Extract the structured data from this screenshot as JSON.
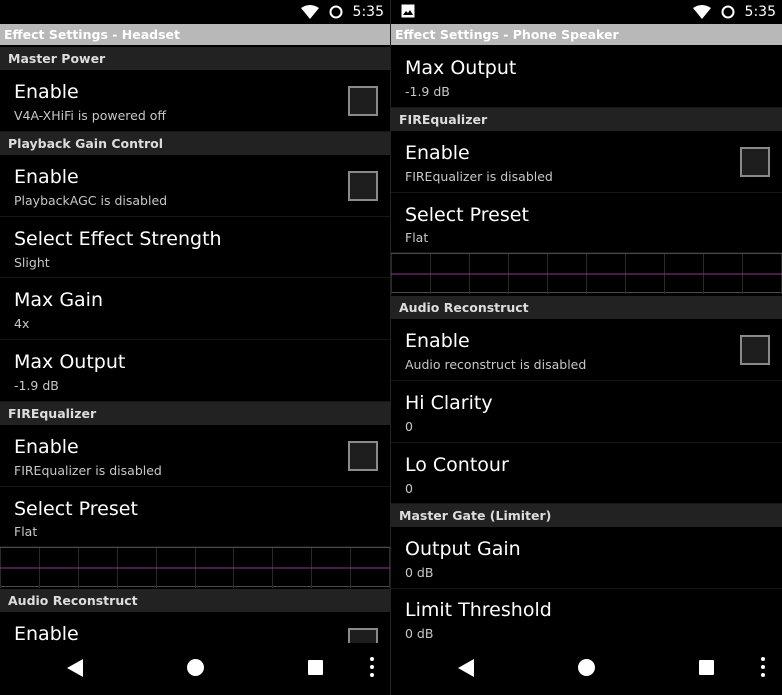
{
  "status": {
    "time": "5:35"
  },
  "left": {
    "title": "Effect Settings - Headset",
    "master_power": {
      "header": "Master Power",
      "enable_title": "Enable",
      "enable_summary": "V4A-XHiFi is powered off"
    },
    "playback_gain": {
      "header": "Playback Gain Control",
      "enable_title": "Enable",
      "enable_summary": "PlaybackAGC is disabled",
      "strength_title": "Select Effect Strength",
      "strength_value": "Slight",
      "max_gain_title": "Max Gain",
      "max_gain_value": "4x",
      "max_output_title": "Max Output",
      "max_output_value": "-1.9 dB"
    },
    "fir_equalizer": {
      "header": "FIREqualizer",
      "enable_title": "Enable",
      "enable_summary": "FIREqualizer is disabled",
      "preset_title": "Select Preset",
      "preset_value": "Flat"
    },
    "audio_reconstruct": {
      "header": "Audio Reconstruct",
      "enable_title": "Enable"
    }
  },
  "right": {
    "title": "Effect Settings - Phone Speaker",
    "max_output_title": "Max Output",
    "max_output_value": "-1.9 dB",
    "fir_equalizer": {
      "header": "FIREqualizer",
      "enable_title": "Enable",
      "enable_summary": "FIREqualizer is disabled",
      "preset_title": "Select Preset",
      "preset_value": "Flat"
    },
    "audio_reconstruct": {
      "header": "Audio Reconstruct",
      "enable_title": "Enable",
      "enable_summary": "Audio reconstruct is disabled",
      "hi_clarity_title": "Hi Clarity",
      "hi_clarity_value": "0",
      "lo_contour_title": "Lo Contour",
      "lo_contour_value": "0"
    },
    "master_gate": {
      "header": "Master Gate (Limiter)",
      "output_gain_title": "Output Gain",
      "output_gain_value": "0 dB",
      "limit_threshold_title": "Limit Threshold",
      "limit_threshold_value": "0 dB"
    }
  },
  "colors": {
    "titlebar": "#b8b8b8",
    "category": "#222222",
    "eq_line": "#8a3a8a"
  }
}
